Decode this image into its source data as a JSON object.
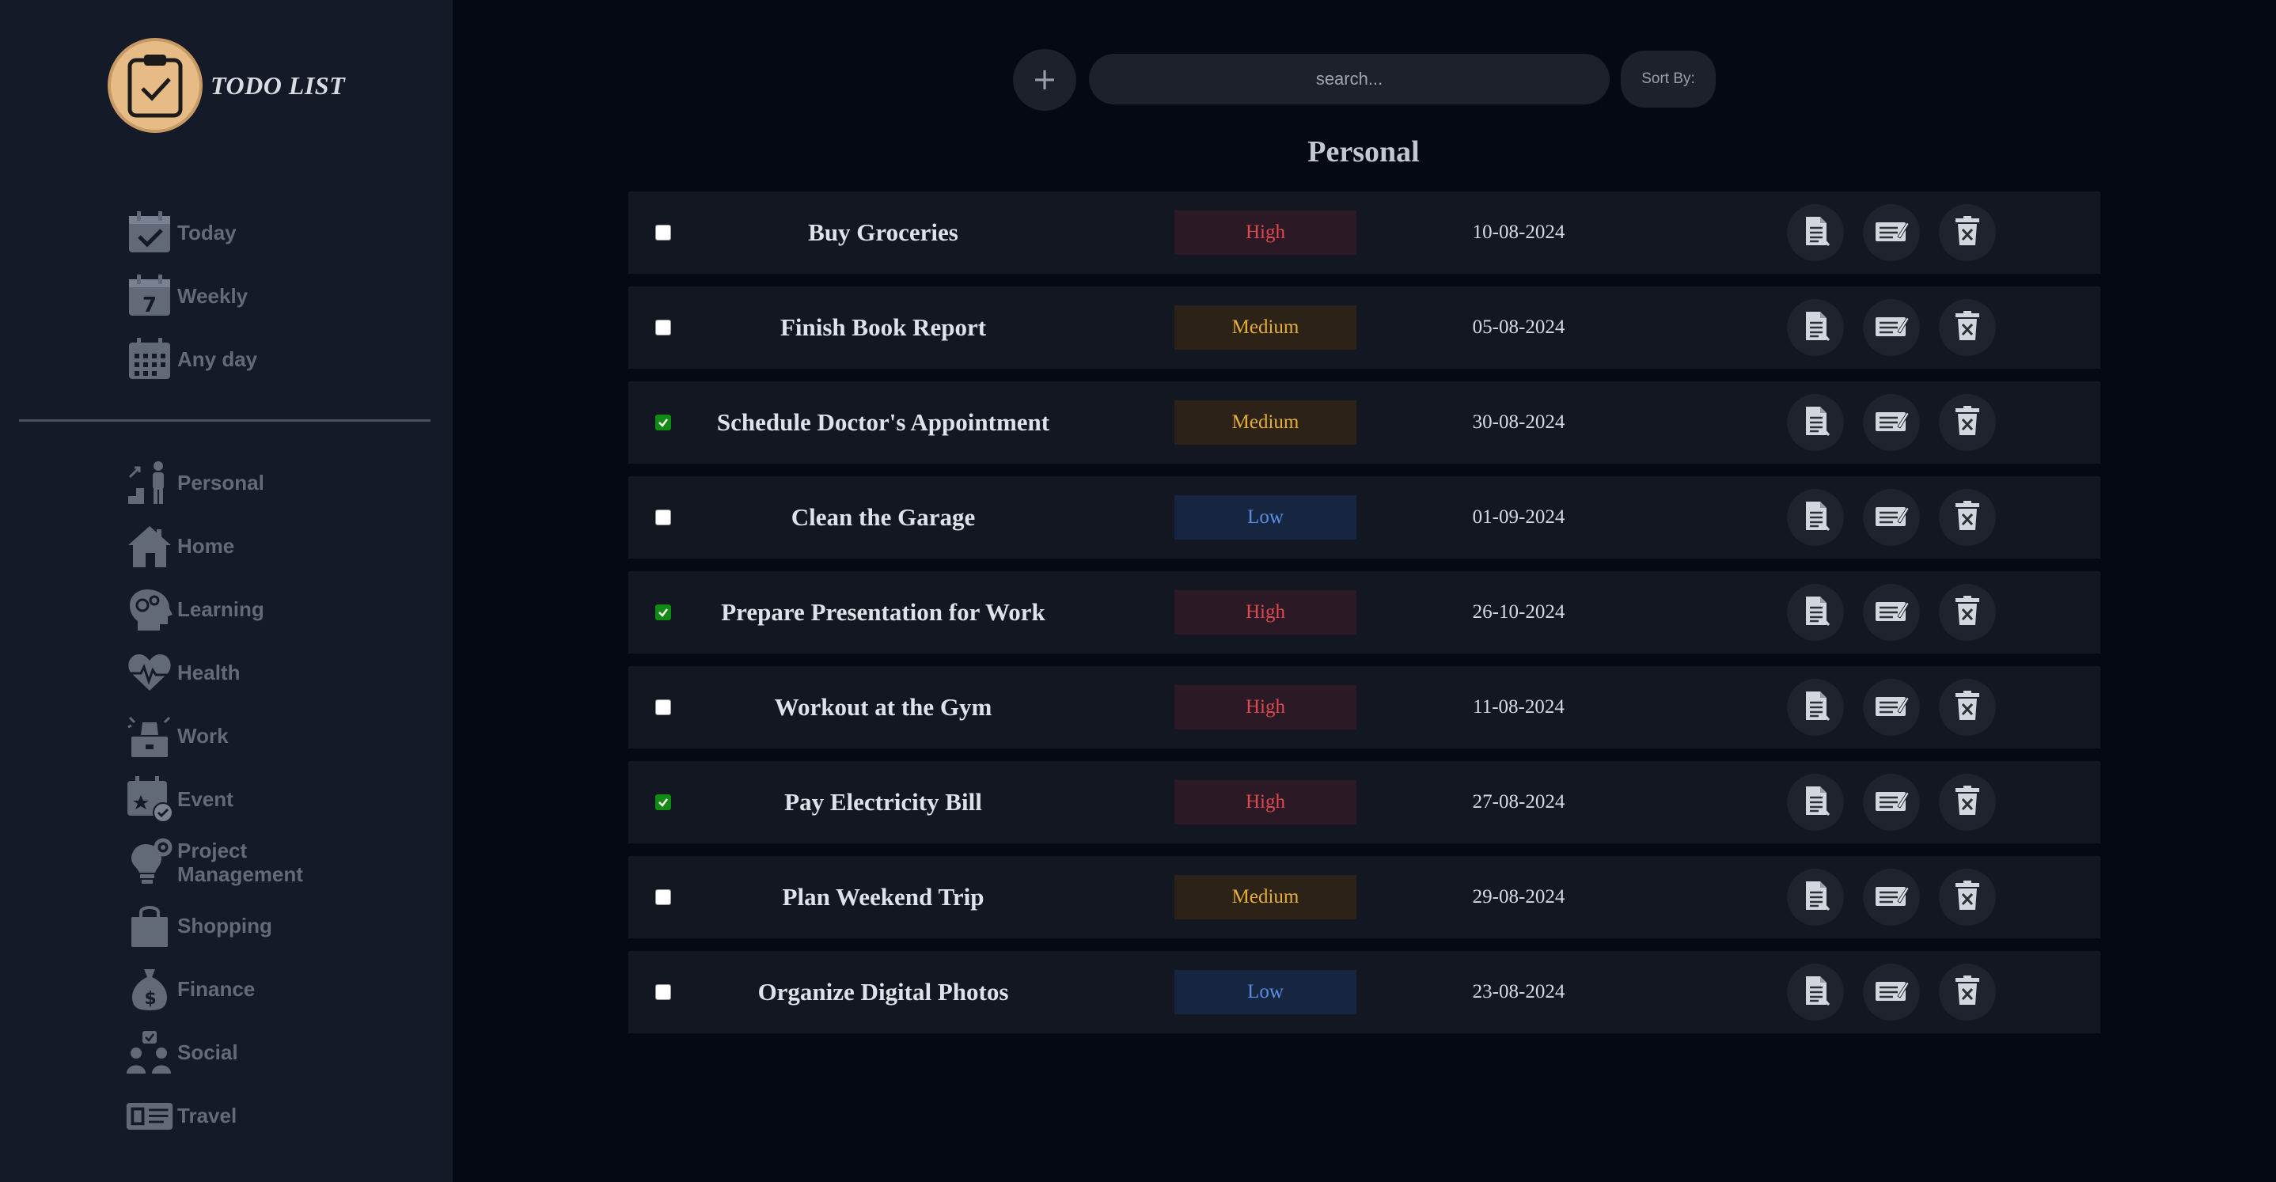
{
  "app": {
    "title": "TODO LIST"
  },
  "sidebar": {
    "dates": [
      {
        "label": "Today",
        "icon": "calendar-check-icon"
      },
      {
        "label": "Weekly",
        "icon": "calendar-7-icon"
      },
      {
        "label": "Any day",
        "icon": "calendar-grid-icon"
      }
    ],
    "categories": [
      {
        "label": "Personal",
        "icon": "person-stairs-icon"
      },
      {
        "label": "Home",
        "icon": "house-icon"
      },
      {
        "label": "Learning",
        "icon": "head-gears-icon"
      },
      {
        "label": "Health",
        "icon": "heart-pulse-icon"
      },
      {
        "label": "Work",
        "icon": "worker-desk-icon"
      },
      {
        "label": "Event",
        "icon": "calendar-star-icon"
      },
      {
        "label": "Project Management",
        "icon": "lightbulb-gear-icon"
      },
      {
        "label": "Shopping",
        "icon": "shopping-bag-icon"
      },
      {
        "label": "Finance",
        "icon": "money-bag-icon"
      },
      {
        "label": "Social",
        "icon": "people-icon"
      },
      {
        "label": "Travel",
        "icon": "passport-icon"
      }
    ]
  },
  "toolbar": {
    "add_label": "+",
    "search_placeholder": "search...",
    "sort_label": "Sort By:"
  },
  "main": {
    "section_title": "Personal",
    "tasks": [
      {
        "title": "Buy Groceries",
        "priority": "High",
        "date": "10-08-2024",
        "done": false
      },
      {
        "title": "Finish Book Report",
        "priority": "Medium",
        "date": "05-08-2024",
        "done": false
      },
      {
        "title": "Schedule Doctor's Appointment",
        "priority": "Medium",
        "date": "30-08-2024",
        "done": true
      },
      {
        "title": "Clean the Garage",
        "priority": "Low",
        "date": "01-09-2024",
        "done": false
      },
      {
        "title": "Prepare Presentation for Work",
        "priority": "High",
        "date": "26-10-2024",
        "done": true
      },
      {
        "title": "Workout at the Gym",
        "priority": "High",
        "date": "11-08-2024",
        "done": false
      },
      {
        "title": "Pay Electricity Bill",
        "priority": "High",
        "date": "27-08-2024",
        "done": true
      },
      {
        "title": "Plan Weekend Trip",
        "priority": "Medium",
        "date": "29-08-2024",
        "done": false
      },
      {
        "title": "Organize Digital Photos",
        "priority": "Low",
        "date": "23-08-2024",
        "done": false
      }
    ]
  },
  "colors": {
    "high": "#e0474f",
    "medium": "#e4ad3a",
    "low": "#5c8ce6",
    "checked": "#138a13",
    "logo": "#e6bb85"
  }
}
